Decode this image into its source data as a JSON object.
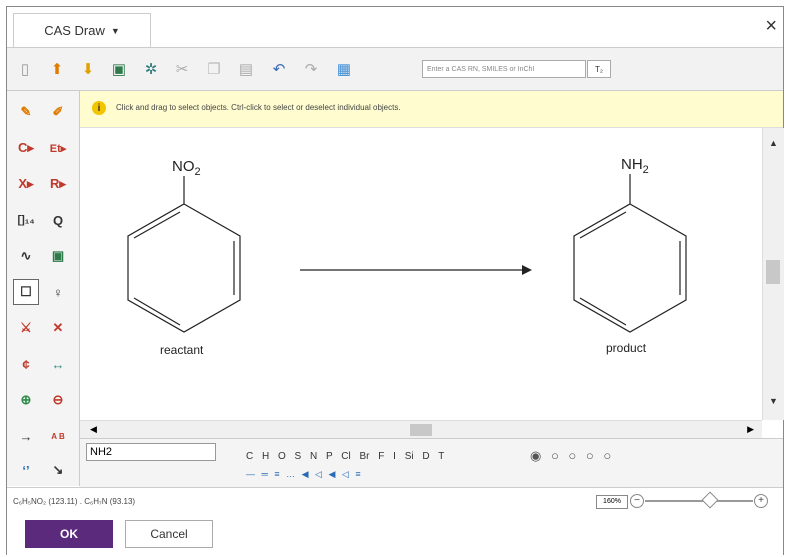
{
  "window": {
    "title": "CAS Draw",
    "close_symbol": "×"
  },
  "toolbar": {
    "search_placeholder": "Enter a CAS RN, SMILES or InChI",
    "search_button_label": "T₂",
    "icons": [
      "new-icon",
      "import-icon",
      "export-icon",
      "template-icon",
      "settings-icon",
      "cut-icon",
      "copy-icon",
      "paste-icon",
      "undo-icon",
      "redo-icon",
      "table-icon"
    ]
  },
  "hint": {
    "text": "Click and drag to select objects. Ctrl-click to select or deselect individual objects.",
    "icon_glyph": "i"
  },
  "left_tools": {
    "carbon": "C▸",
    "ethyl": "Et▸",
    "halogen": "X▸",
    "rgroup": "R▸",
    "bracket": "[]₁₄",
    "query": "Q",
    "chain": "∿",
    "ring": "▣",
    "lasso_select": "☐",
    "lasso": "♀",
    "atom_map": "⚔",
    "bond_break": "✕",
    "stereo": "¢",
    "link": "↔",
    "plus": "⊕",
    "minus": "⊖",
    "arrow": "→",
    "text": "A B",
    "polymer": "‘’",
    "pointer": "↘"
  },
  "canvas": {
    "reactant_group_main": "NO",
    "reactant_group_sub": "2",
    "reactant_label": "reactant",
    "product_group_main": "NH",
    "product_group_sub": "2",
    "product_label": "product"
  },
  "bottom": {
    "symbol_input": "NH2",
    "elements": "C H O S N P Cl Br F I Si D T",
    "shape_glyphs": "◉ ○ ○ ○ ○",
    "bond_glyphs": "— ═ ≡ … ◀ ◁ ◀ ◁ ≡"
  },
  "status": {
    "formula": "C₆H₅NO₂ (123.11) . C₆H₇N (93.13)",
    "zoom": "160%",
    "zoom_level_percent": 55
  },
  "footer": {
    "ok_label": "OK",
    "cancel_label": "Cancel"
  },
  "colors": {
    "accent": "#5b2a7c",
    "hint_bg": "#fffdd0",
    "tool_red": "#c0392b",
    "tool_teal": "#2e8b7a"
  }
}
